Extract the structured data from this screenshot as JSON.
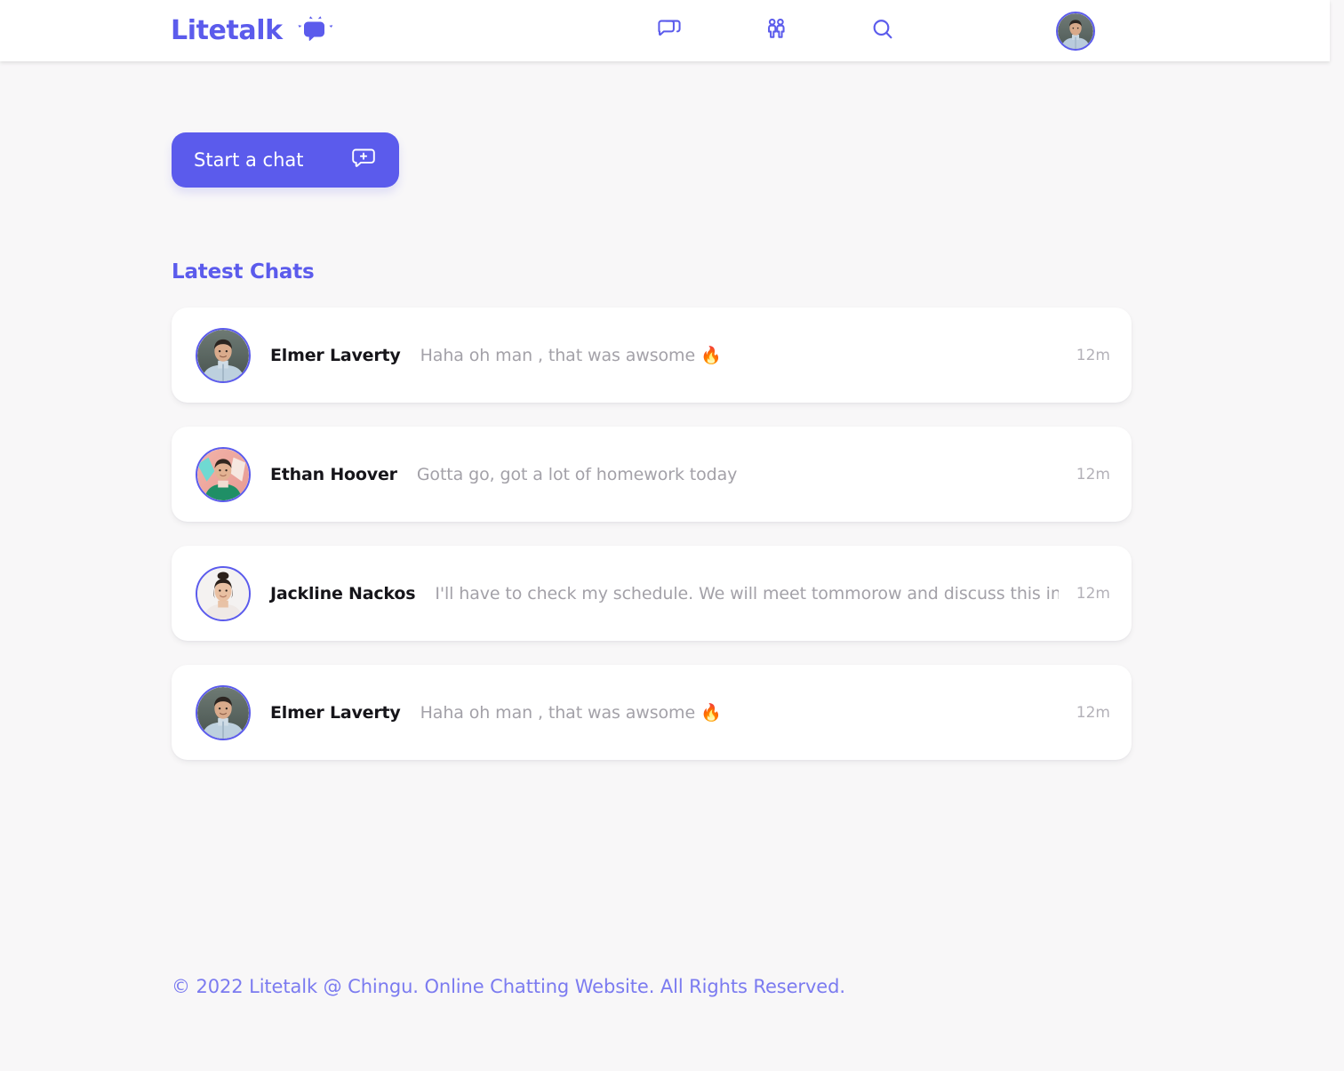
{
  "brand": {
    "name": "Litetalk",
    "logo_icon": "speech-bubble-sparkle-icon",
    "color": "#5b5bec"
  },
  "header": {
    "nav": [
      {
        "icon": "chats-icon",
        "label": "Chats"
      },
      {
        "icon": "friends-icon",
        "label": "Friends"
      },
      {
        "icon": "search-icon",
        "label": "Search"
      }
    ],
    "avatar": {
      "icon": "avatar",
      "alt": "User profile"
    }
  },
  "main": {
    "start_chat": {
      "label": "Start a chat",
      "icon": "new-message-icon"
    },
    "section_title": "Latest Chats",
    "chats": [
      {
        "name": "Elmer Laverty",
        "message": "Haha oh man , that was awsome 🔥",
        "time": "12m",
        "avatar": "elmer"
      },
      {
        "name": "Ethan Hoover",
        "message": "Gotta go, got a lot of homework today",
        "time": "12m",
        "avatar": "ethan"
      },
      {
        "name": "Jackline Nackos",
        "message": "I'll have to check my schedule. We will meet tommorow and discuss this in . . .",
        "time": "12m",
        "avatar": "jackline"
      },
      {
        "name": "Elmer Laverty",
        "message": "Haha oh man , that was awsome 🔥",
        "time": "12m",
        "avatar": "elmer"
      }
    ]
  },
  "footer": {
    "text": "© 2022 Litetalk @ Chingu. Online Chatting Website. All Rights Reserved."
  }
}
